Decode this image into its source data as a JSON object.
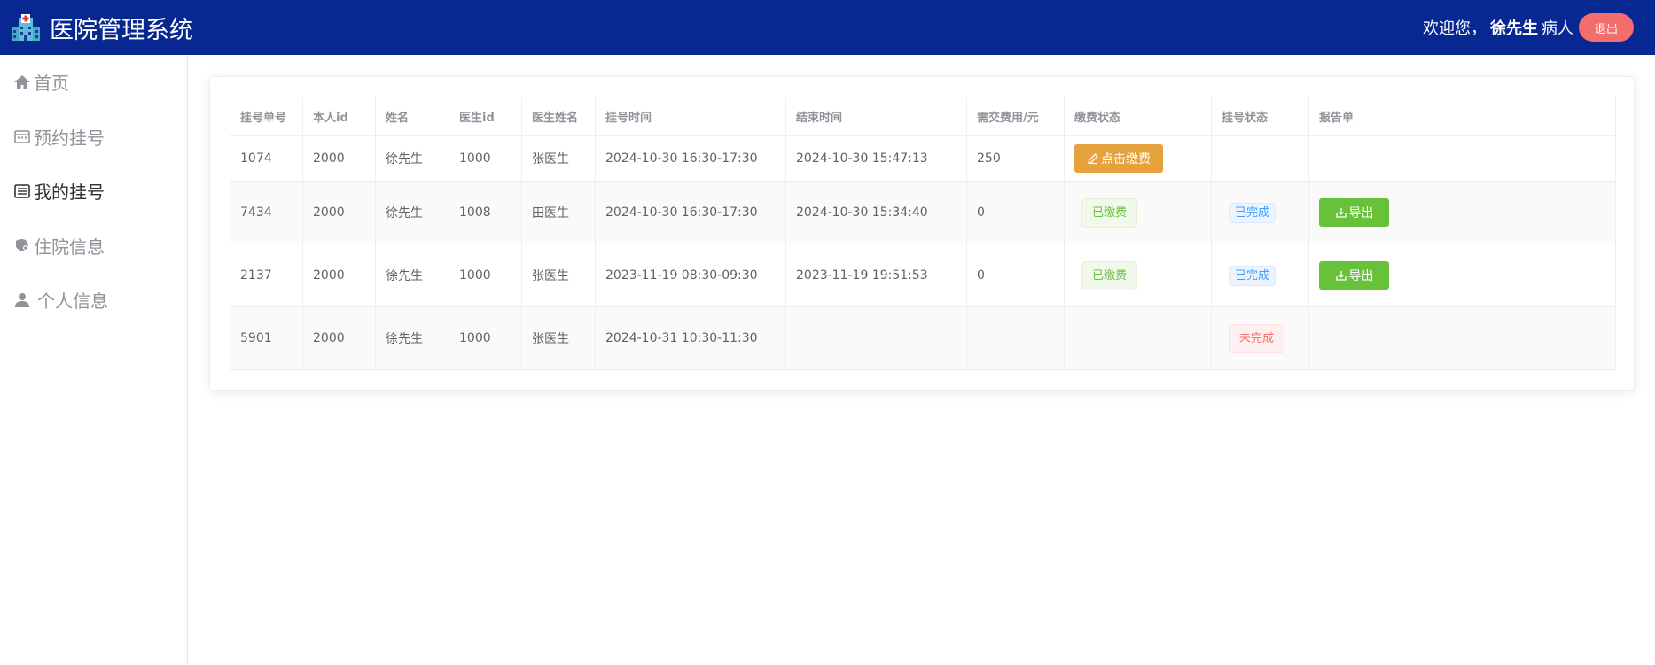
{
  "header": {
    "title": "医院管理系统",
    "welcome_prefix": "欢迎您，",
    "username": "徐先生",
    "role": "病人",
    "logout_label": "退出",
    "logo_icon": "hospital-icon",
    "bg_color": "#082891"
  },
  "sidebar": {
    "items": [
      {
        "label": "首页",
        "icon": "home-icon",
        "active": false
      },
      {
        "label": "预约挂号",
        "icon": "calendar-icon",
        "active": false
      },
      {
        "label": "我的挂号",
        "icon": "list-icon",
        "active": true
      },
      {
        "label": "住院信息",
        "icon": "bed-icon",
        "active": false
      },
      {
        "label": "个人信息",
        "icon": "user-icon",
        "active": false
      }
    ]
  },
  "table": {
    "headers": [
      "挂号单号",
      "本人id",
      "姓名",
      "医生id",
      "医生姓名",
      "挂号时间",
      "结束时间",
      "需交费用/元",
      "缴费状态",
      "挂号状态",
      "报告单"
    ],
    "rows": [
      {
        "id": "1074",
        "pid": "2000",
        "name": "徐先生",
        "did": "1000",
        "dname": "张医生",
        "time": "2024-10-30 16:30-17:30",
        "end": "2024-10-30 15:47:13",
        "fee": "250",
        "pay": "点击缴费",
        "status": "",
        "report": ""
      },
      {
        "id": "7434",
        "pid": "2000",
        "name": "徐先生",
        "did": "1008",
        "dname": "田医生",
        "time": "2024-10-30 16:30-17:30",
        "end": "2024-10-30 15:34:40",
        "fee": "0",
        "pay": "已缴费",
        "status": "已完成",
        "report": "导出"
      },
      {
        "id": "2137",
        "pid": "2000",
        "name": "徐先生",
        "did": "1000",
        "dname": "张医生",
        "time": "2023-11-19 08:30-09:30",
        "end": "2023-11-19 19:51:53",
        "fee": "0",
        "pay": "已缴费",
        "status": "已完成",
        "report": "导出"
      },
      {
        "id": "5901",
        "pid": "2000",
        "name": "徐先生",
        "did": "1000",
        "dname": "张医生",
        "time": "2024-10-31 10:30-11:30",
        "end": "",
        "fee": "",
        "pay": "",
        "status": "未完成",
        "report": ""
      }
    ]
  },
  "colors": {
    "pay_button": "#e6a23c",
    "export_button": "#67c23a",
    "logout_button": "#f56c6c",
    "success_tag": "#67c23a",
    "info_tag": "#409eff",
    "danger_tag": "#f56c6c"
  }
}
